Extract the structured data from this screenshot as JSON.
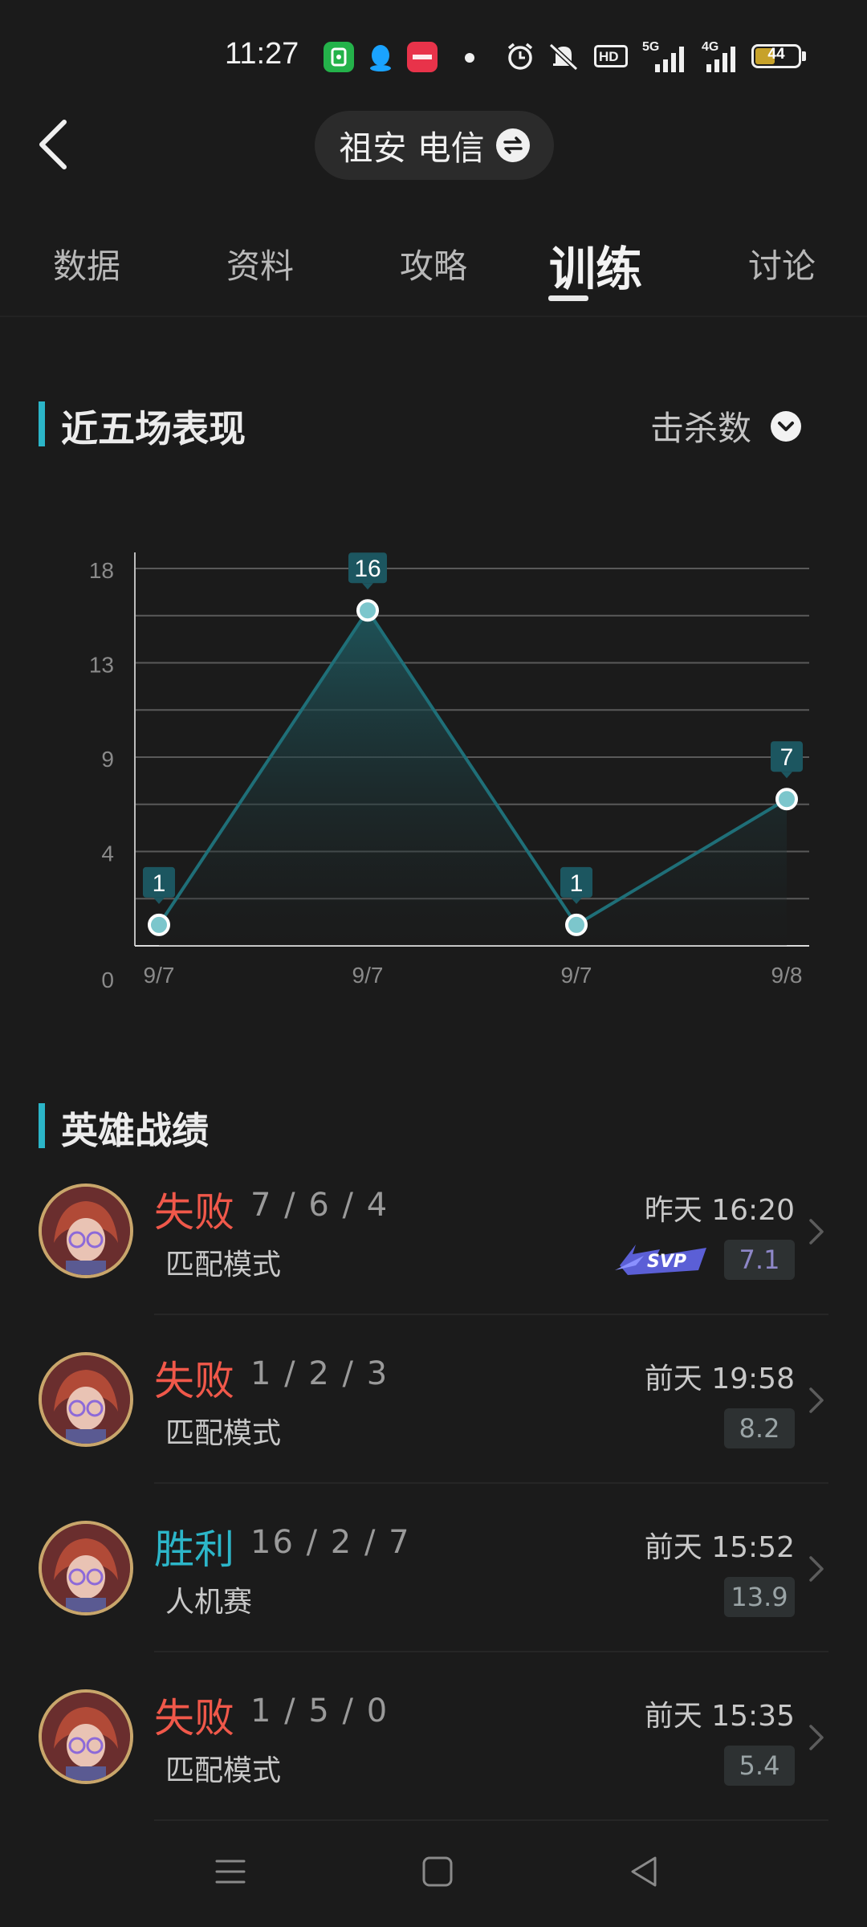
{
  "status_bar": {
    "time": "11:27",
    "icons": [
      "wechat-pay-app-icon",
      "qq-app-icon",
      "xiaohongshu-app-icon",
      "alarm-icon",
      "mute-icon",
      "hd-icon",
      "5g-signal-icon",
      "4g-signal-icon",
      "battery-icon"
    ],
    "network_5g": "5G",
    "network_4g": "4G",
    "hd": "HD",
    "battery": "44"
  },
  "header": {
    "account": "祖安 电信",
    "back_icon": "chevron-left-icon",
    "swap_icon": "swap-icon"
  },
  "tabs": [
    {
      "label": "数据",
      "active": false
    },
    {
      "label": "资料",
      "active": false
    },
    {
      "label": "攻略",
      "active": false
    },
    {
      "label": "训练",
      "active": true
    },
    {
      "label": "讨论",
      "active": false
    }
  ],
  "performance": {
    "title": "近五场表现",
    "metric": "击杀数"
  },
  "chart_data": {
    "type": "area",
    "categories": [
      "9/7",
      "9/7",
      "9/7",
      "9/8"
    ],
    "values": [
      1,
      16,
      1,
      7
    ],
    "y_ticks": [
      "18",
      "13",
      "9",
      "4",
      "0"
    ],
    "ylim": [
      0,
      18
    ],
    "grid": true,
    "colors": {
      "line": "#1f6f78",
      "point": "#7cc6cc",
      "label_bg": "#1c5660"
    }
  },
  "hero_record": {
    "title": "英雄战绩",
    "matches": [
      {
        "result": "失败",
        "outcome": "lose",
        "kda": "7 / 6 / 4",
        "mode": "匹配模式",
        "time": "昨天 16:20",
        "score": "7.1",
        "badge": "SVP"
      },
      {
        "result": "失败",
        "outcome": "lose",
        "kda": "1 / 2 / 3",
        "mode": "匹配模式",
        "time": "前天 19:58",
        "score": "8.2",
        "badge": ""
      },
      {
        "result": "胜利",
        "outcome": "win",
        "kda": "16 / 2 / 7",
        "mode": "人机赛",
        "time": "前天 15:52",
        "score": "13.9",
        "badge": ""
      },
      {
        "result": "失败",
        "outcome": "lose",
        "kda": "1 / 5 / 0",
        "mode": "匹配模式",
        "time": "前天 15:35",
        "score": "5.4",
        "badge": ""
      }
    ]
  },
  "nav": [
    "menu-icon",
    "home-square-icon",
    "back-triangle-icon"
  ],
  "colors": {
    "accent": "#2bb5c8",
    "lose": "#f0584a",
    "win": "#2cb6c9",
    "background": "#1b1b1b"
  }
}
